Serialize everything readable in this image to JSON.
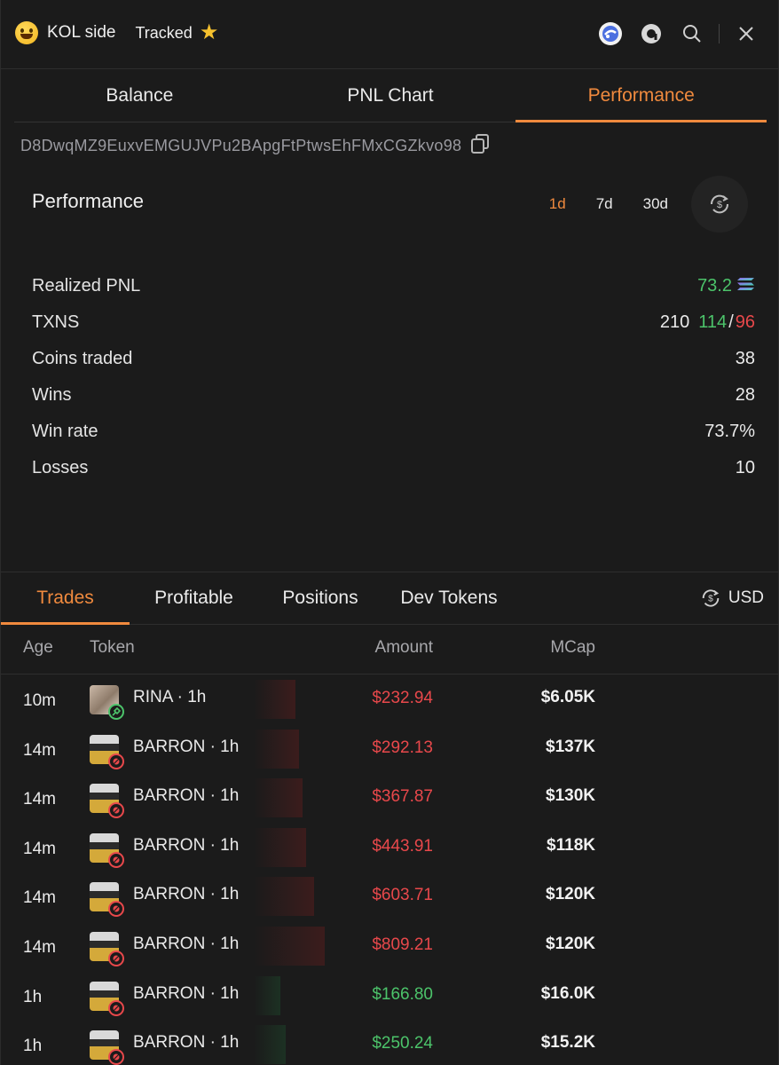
{
  "header": {
    "title": "KOL side",
    "tracked_label": "Tracked",
    "tracked_icon": "star-icon"
  },
  "top_tabs": [
    {
      "label": "Balance",
      "active": false
    },
    {
      "label": "PNL Chart",
      "active": false
    },
    {
      "label": "Performance",
      "active": true
    }
  ],
  "wallet_address": "D8DwqMZ9EuxvEMGUJVPu2BApgFtPtwsEhFMxCGZkvo98",
  "performance": {
    "title": "Performance",
    "ranges": [
      {
        "label": "1d",
        "active": true
      },
      {
        "label": "7d",
        "active": false
      },
      {
        "label": "30d",
        "active": false
      }
    ],
    "stats": {
      "realized_pnl_label": "Realized PNL",
      "realized_pnl_value": "73.2",
      "txns_label": "TXNS",
      "txns_total": "210",
      "txns_buys": "114",
      "txns_sells": "96",
      "coins_label": "Coins traded",
      "coins_value": "38",
      "wins_label": "Wins",
      "wins_value": "28",
      "winrate_label": "Win rate",
      "winrate_value": "73.7%",
      "losses_label": "Losses",
      "losses_value": "10"
    }
  },
  "bottom_tabs": [
    {
      "label": "Trades",
      "active": true
    },
    {
      "label": "Profitable",
      "active": false
    },
    {
      "label": "Positions",
      "active": false
    },
    {
      "label": "Dev Tokens",
      "active": false
    }
  ],
  "currency_toggle": "USD",
  "table": {
    "columns": [
      "Age",
      "Token",
      "Amount",
      "MCap"
    ],
    "rows": [
      {
        "age": "10m",
        "token": "RINA",
        "token_age": "1h",
        "amount": "$232.94",
        "side": "sell",
        "mcap": "$6.05K"
      },
      {
        "age": "14m",
        "token": "BARRON",
        "token_age": "1h",
        "amount": "$292.13",
        "side": "sell",
        "mcap": "$137K"
      },
      {
        "age": "14m",
        "token": "BARRON",
        "token_age": "1h",
        "amount": "$367.87",
        "side": "sell",
        "mcap": "$130K"
      },
      {
        "age": "14m",
        "token": "BARRON",
        "token_age": "1h",
        "amount": "$443.91",
        "side": "sell",
        "mcap": "$118K"
      },
      {
        "age": "14m",
        "token": "BARRON",
        "token_age": "1h",
        "amount": "$603.71",
        "side": "sell",
        "mcap": "$120K"
      },
      {
        "age": "14m",
        "token": "BARRON",
        "token_age": "1h",
        "amount": "$809.21",
        "side": "sell",
        "mcap": "$120K"
      },
      {
        "age": "1h",
        "token": "BARRON",
        "token_age": "1h",
        "amount": "$166.80",
        "side": "buy",
        "mcap": "$16.0K"
      },
      {
        "age": "1h",
        "token": "BARRON",
        "token_age": "1h",
        "amount": "$250.24",
        "side": "buy",
        "mcap": "$15.2K"
      }
    ]
  },
  "colors": {
    "accent": "#f08a3e",
    "positive": "#4cc36a",
    "negative": "#e8484b",
    "background": "#1b1b1b"
  }
}
